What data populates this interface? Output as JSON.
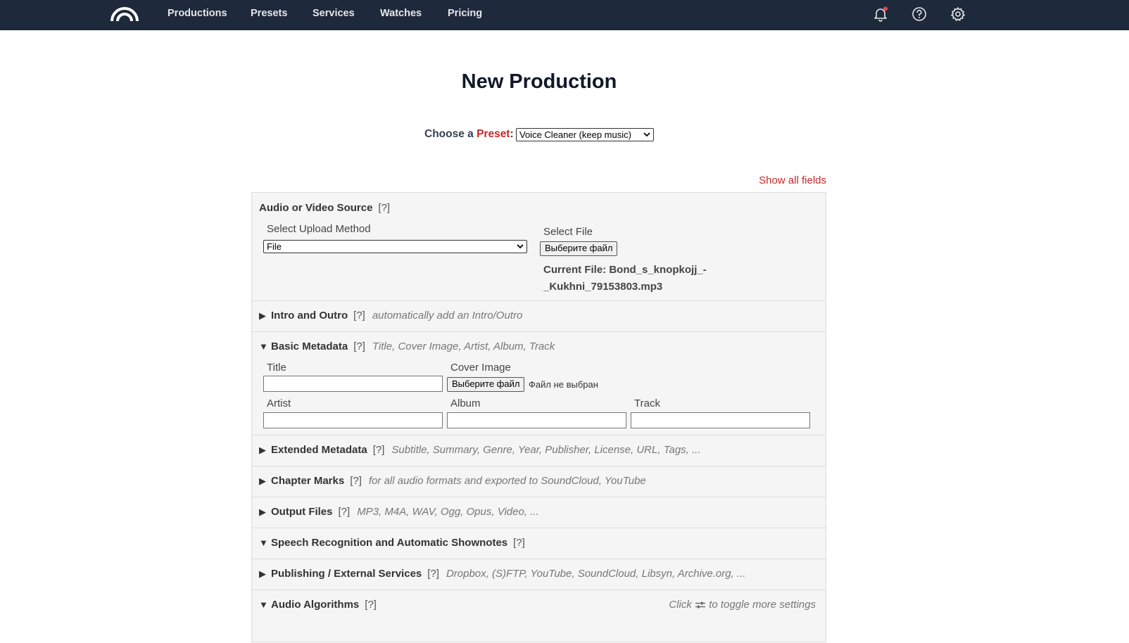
{
  "nav": {
    "items": [
      "Productions",
      "Presets",
      "Services",
      "Watches",
      "Pricing"
    ]
  },
  "page": {
    "title": "New Production",
    "preset_prefix": "Choose a",
    "preset_word": "Preset",
    "preset_suffix": ":",
    "preset_value": "Voice Cleaner (keep music)",
    "show_all": "Show all fields"
  },
  "source": {
    "title": "Audio or Video Source",
    "help": "[?]",
    "method_label": "Select Upload Method",
    "method_value": "File",
    "file_label": "Select File",
    "file_button": "Выберите файл",
    "current_file": "Current File: Bond_s_knopkojj_-_Kukhni_79153803.mp3"
  },
  "sections": {
    "intro": {
      "title": "Intro and Outro",
      "help": "[?]",
      "desc": "automatically add an Intro/Outro",
      "arrow": "▶"
    },
    "basic": {
      "title": "Basic Metadata",
      "help": "[?]",
      "desc": "Title, Cover Image, Artist, Album, Track",
      "arrow": "▼"
    },
    "extended": {
      "title": "Extended Metadata",
      "help": "[?]",
      "desc": "Subtitle, Summary, Genre, Year, Publisher, License, URL, Tags, ...",
      "arrow": "▶"
    },
    "chapters": {
      "title": "Chapter Marks",
      "help": "[?]",
      "desc": "for all audio formats and exported to SoundCloud, YouTube",
      "arrow": "▶"
    },
    "output": {
      "title": "Output Files",
      "help": "[?]",
      "desc": "MP3, M4A, WAV, Ogg, Opus, Video, ...",
      "arrow": "▶"
    },
    "speech": {
      "title": "Speech Recognition and Automatic Shownotes",
      "help": "[?]",
      "desc": "",
      "arrow": "▼"
    },
    "publishing": {
      "title": "Publishing / External Services",
      "help": "[?]",
      "desc": "Dropbox, (S)FTP, YouTube, SoundCloud, Libsyn, Archive.org, ...",
      "arrow": "▶"
    },
    "algorithms": {
      "title": "Audio Algorithms",
      "help": "[?]",
      "desc": "",
      "arrow": "▼",
      "hint_before": "Click",
      "hint_after": "to toggle more settings"
    }
  },
  "basic_fields": {
    "title_label": "Title",
    "cover_label": "Cover Image",
    "cover_button": "Выберите файл",
    "cover_none": "Файл не выбран",
    "artist_label": "Artist",
    "album_label": "Album",
    "track_label": "Track"
  },
  "colors": {
    "topbar": "#1e293b",
    "accent": "#c62828",
    "panel_bg": "#f5f5f5",
    "notification_dot": "#ef4444"
  },
  "icons": [
    "logo-icon",
    "bell-icon",
    "help-circle-icon",
    "gear-icon",
    "sliders-icon",
    "chevron-down-icon"
  ]
}
